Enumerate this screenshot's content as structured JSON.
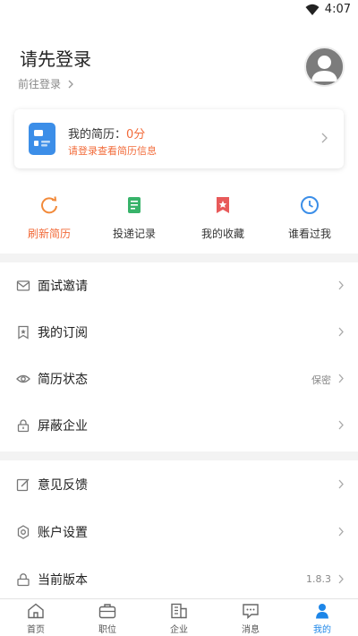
{
  "status_bar": {
    "time": "4:07"
  },
  "header": {
    "title": "请先登录",
    "login_link": "前往登录"
  },
  "resume_card": {
    "label": "我的简历：",
    "score": "0分",
    "hint": "请登录查看简历信息"
  },
  "quick_actions": [
    {
      "label": "刷新简历",
      "icon": "refresh-icon",
      "color": "#f28a3a",
      "active": true
    },
    {
      "label": "投递记录",
      "icon": "document-icon",
      "color": "#38b36a",
      "active": false
    },
    {
      "label": "我的收藏",
      "icon": "bookmark-icon",
      "color": "#e85a5a",
      "active": false
    },
    {
      "label": "谁看过我",
      "icon": "clock-icon",
      "color": "#3b8ee8",
      "active": false
    }
  ],
  "menu_group1": [
    {
      "label": "面试邀请",
      "icon": "mail-icon",
      "value": ""
    },
    {
      "label": "我的订阅",
      "icon": "bookmark-outline-icon",
      "value": ""
    },
    {
      "label": "简历状态",
      "icon": "eye-icon",
      "value": "保密"
    },
    {
      "label": "屏蔽企业",
      "icon": "lock-icon",
      "value": ""
    }
  ],
  "menu_group2": [
    {
      "label": "意见反馈",
      "icon": "edit-icon",
      "value": ""
    },
    {
      "label": "账户设置",
      "icon": "settings-icon",
      "value": ""
    },
    {
      "label": "当前版本",
      "icon": "user-lock-icon",
      "value": "1.8.3"
    }
  ],
  "tab_bar": [
    {
      "label": "首页",
      "icon": "home-icon",
      "active": false
    },
    {
      "label": "职位",
      "icon": "briefcase-icon",
      "active": false
    },
    {
      "label": "企业",
      "icon": "building-icon",
      "active": false
    },
    {
      "label": "消息",
      "icon": "message-icon",
      "active": false
    },
    {
      "label": "我的",
      "icon": "person-icon",
      "active": true
    }
  ],
  "colors": {
    "accent_orange": "#f26b3a",
    "accent_blue": "#1d86e8"
  }
}
